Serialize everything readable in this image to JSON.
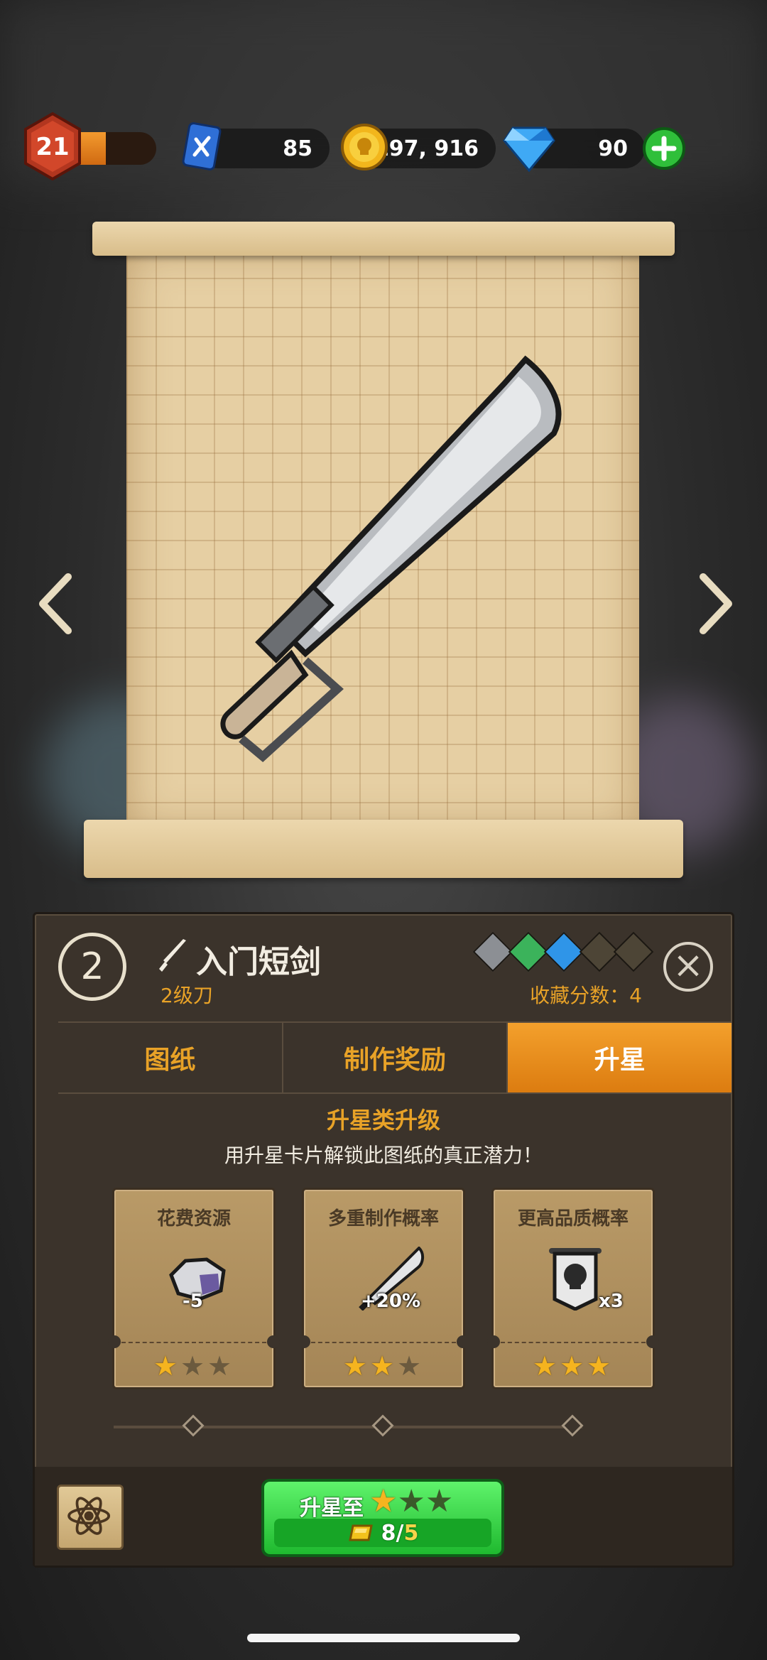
{
  "hud": {
    "player_level": "21",
    "level_progress": 0.35,
    "tools_count": "85",
    "coins": "197, 916",
    "gems": "90"
  },
  "item": {
    "star_level": "2",
    "name": "入门短剑",
    "type": "2级刀",
    "collection_score": "收藏分数：4",
    "gem_slots": [
      "gray",
      "green",
      "blue",
      "empty",
      "empty"
    ]
  },
  "tabs": [
    {
      "label": "图纸",
      "active": false
    },
    {
      "label": "制作奖励",
      "active": false
    },
    {
      "label": "升星",
      "active": true
    }
  ],
  "upgrade_section": {
    "title": "升星类升级",
    "description": "用升星卡片解锁此图纸的真正潜力！",
    "cards": [
      {
        "title": "花费资源",
        "value": "-5",
        "icon": "ore-icon",
        "stars_filled": 1
      },
      {
        "title": "多重制作概率",
        "value": "+20%",
        "icon": "sword-icon",
        "stars_filled": 2
      },
      {
        "title": "更高品质概率",
        "value": "x3",
        "icon": "skull-banner-icon",
        "stars_filled": 3
      }
    ]
  },
  "upgrade_button": {
    "label": "升星至",
    "target_stars_filled": 1,
    "target_stars_total": 3,
    "cost_current": "8",
    "cost_required": "5",
    "cost_separator": "/"
  },
  "colors": {
    "accent_orange": "#e8a227",
    "button_green": "#1fb92f",
    "panel_bg": "#3b332b"
  }
}
